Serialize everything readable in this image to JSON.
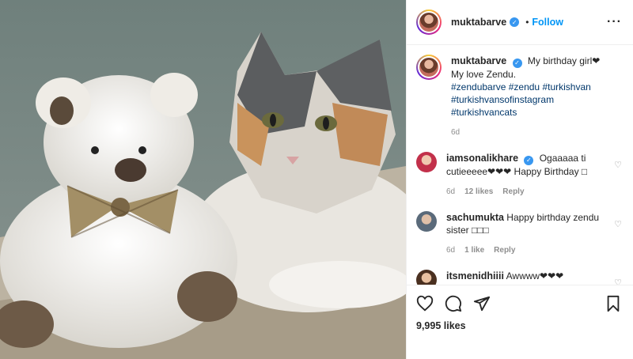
{
  "post": {
    "author": "muktabarve",
    "follow_label": "Follow",
    "caption_text": "My birthday girl❤ My love Zendu.",
    "hashtags": [
      "#zendubarve",
      "#zendu",
      "#turkishvan",
      "#turkishvansofinstagram",
      "#turkishvancats"
    ],
    "caption_time": "6d",
    "likes_count": "9,995 likes"
  },
  "comments": [
    {
      "user": "iamsonalikhare",
      "verified": true,
      "text": "Ogaaaaa ti cutieeeee❤❤❤ Happy Birthday □",
      "time": "6d",
      "likes": "12 likes",
      "reply": "Reply"
    },
    {
      "user": "sachumukta",
      "verified": false,
      "text": "Happy birthday zendu sister □□□",
      "time": "6d",
      "likes": "1 like",
      "reply": "Reply"
    },
    {
      "user": "itsmenidhiiii",
      "verified": false,
      "text": "Awwww❤❤❤"
    }
  ],
  "icons": {
    "like": "heart-icon",
    "comment": "comment-icon",
    "share": "share-icon",
    "save": "bookmark-icon",
    "more": "more-options-icon",
    "verified": "verified-badge-icon"
  },
  "colors": {
    "link_blue": "#0095f6",
    "hashtag": "#00376b",
    "verified": "#3897f0",
    "muted": "#8e8e8e"
  }
}
